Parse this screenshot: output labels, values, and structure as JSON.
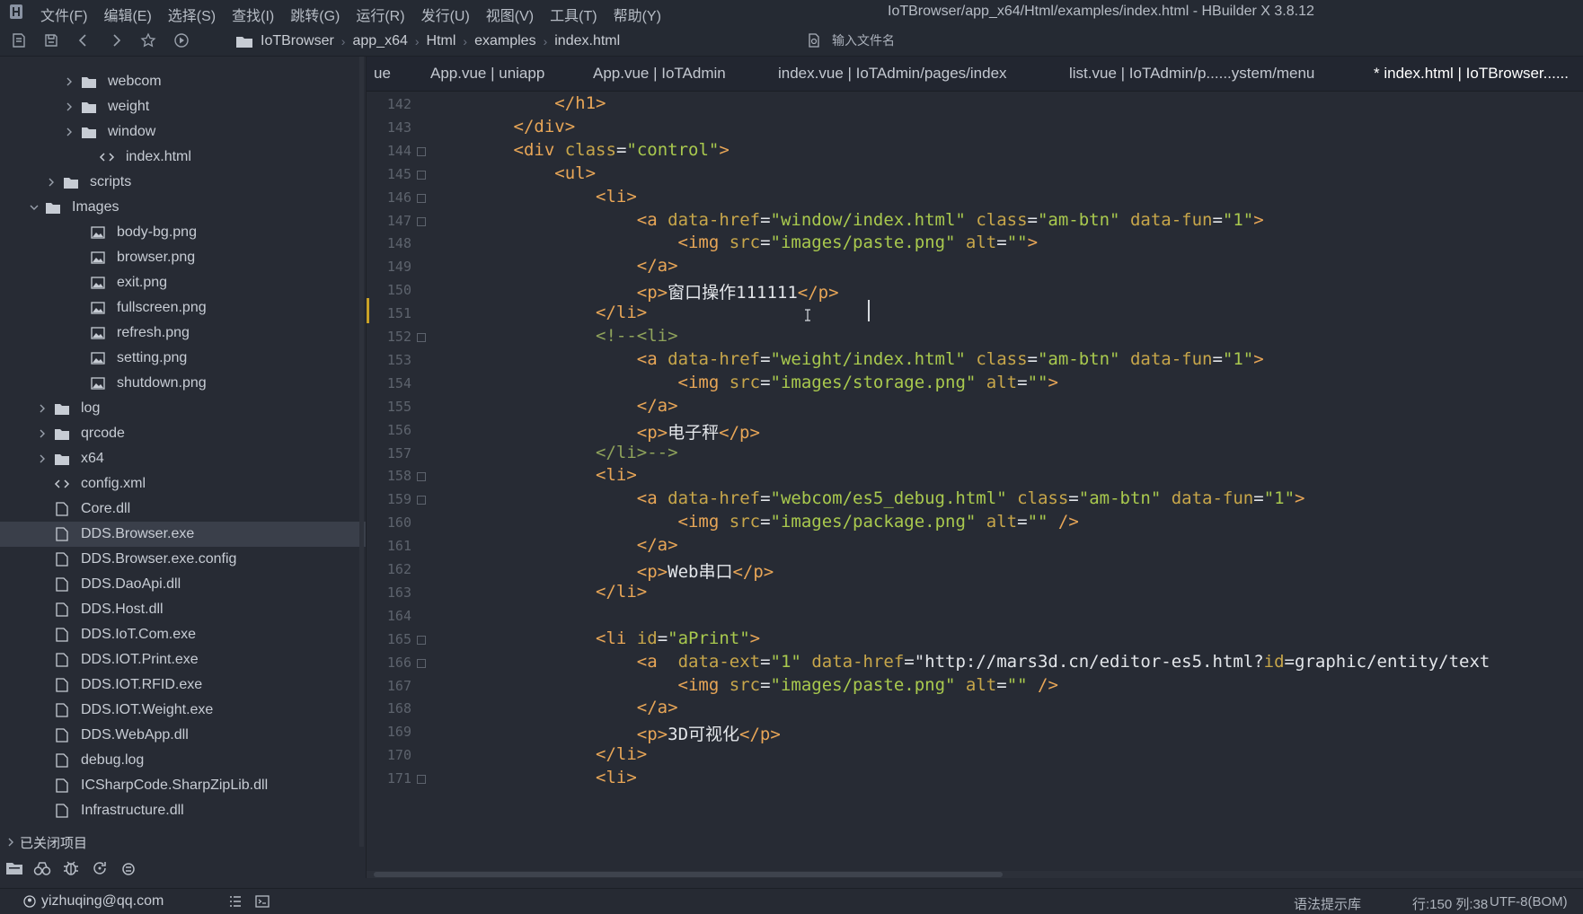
{
  "menu": [
    "文件(F)",
    "编辑(E)",
    "选择(S)",
    "查找(I)",
    "跳转(G)",
    "运行(R)",
    "发行(U)",
    "视图(V)",
    "工具(T)",
    "帮助(Y)"
  ],
  "window_title": "IoTBrowser/app_x64/Html/examples/index.html - HBuilder X 3.8.12",
  "breadcrumb": [
    "IoTBrowser",
    "app_x64",
    "Html",
    "examples",
    "index.html"
  ],
  "file_search_placeholder": "输入文件名",
  "tree": [
    {
      "label": "webcom",
      "type": "folder",
      "expanded": false
    },
    {
      "label": "weight",
      "type": "folder",
      "expanded": false
    },
    {
      "label": "window",
      "type": "folder",
      "expanded": false
    },
    {
      "label": "index.html",
      "type": "html"
    },
    {
      "label": "scripts",
      "type": "folder",
      "expanded": false
    },
    {
      "label": "Images",
      "type": "folder",
      "expanded": true
    },
    {
      "label": "body-bg.png",
      "type": "image"
    },
    {
      "label": "browser.png",
      "type": "image"
    },
    {
      "label": "exit.png",
      "type": "image"
    },
    {
      "label": "fullscreen.png",
      "type": "image"
    },
    {
      "label": "refresh.png",
      "type": "image"
    },
    {
      "label": "setting.png",
      "type": "image"
    },
    {
      "label": "shutdown.png",
      "type": "image"
    },
    {
      "label": "log",
      "type": "folder",
      "expanded": false
    },
    {
      "label": "qrcode",
      "type": "folder",
      "expanded": false
    },
    {
      "label": "x64",
      "type": "folder",
      "expanded": false
    },
    {
      "label": "config.xml",
      "type": "html"
    },
    {
      "label": "Core.dll",
      "type": "file"
    },
    {
      "label": "DDS.Browser.exe",
      "type": "file",
      "selected": true
    },
    {
      "label": "DDS.Browser.exe.config",
      "type": "file"
    },
    {
      "label": "DDS.DaoApi.dll",
      "type": "file"
    },
    {
      "label": "DDS.Host.dll",
      "type": "file"
    },
    {
      "label": "DDS.IoT.Com.exe",
      "type": "file"
    },
    {
      "label": "DDS.IOT.Print.exe",
      "type": "file"
    },
    {
      "label": "DDS.IOT.RFID.exe",
      "type": "file"
    },
    {
      "label": "DDS.IOT.Weight.exe",
      "type": "file"
    },
    {
      "label": "DDS.WebApp.dll",
      "type": "file"
    },
    {
      "label": "debug.log",
      "type": "file"
    },
    {
      "label": "ICSharpCode.SharpZipLib.dll",
      "type": "file"
    },
    {
      "label": "Infrastructure.dll",
      "type": "file"
    }
  ],
  "closed_projects_label": "已关闭项目",
  "tabs": [
    {
      "label": "ue",
      "active": false
    },
    {
      "label": "App.vue | uniapp",
      "active": false
    },
    {
      "label": "App.vue | IoTAdmin",
      "active": false
    },
    {
      "label": "index.vue | IoTAdmin/pages/index",
      "active": false
    },
    {
      "label": "list.vue | IoTAdmin/p......ystem/menu",
      "active": false
    },
    {
      "label": "* index.html | IoTBrowser......",
      "active": true
    }
  ],
  "code_lines": [
    {
      "n": "142",
      "text": "            </h1>"
    },
    {
      "n": "143",
      "text": "        </div>"
    },
    {
      "n": "144",
      "text": "        <div class=\"control\">",
      "fold": true
    },
    {
      "n": "145",
      "text": "            <ul>",
      "fold": true
    },
    {
      "n": "146",
      "text": "                <li>",
      "fold": true
    },
    {
      "n": "147",
      "text": "                    <a data-href=\"window/index.html\" class=\"am-btn\" data-fun=\"1\">",
      "fold": true
    },
    {
      "n": "148",
      "text": "                        <img src=\"images/paste.png\" alt=\"\">"
    },
    {
      "n": "149",
      "text": "                    </a>"
    },
    {
      "n": "150",
      "text": "                    <p>窗口操作111111</p>",
      "modified": true
    },
    {
      "n": "151",
      "text": "                </li>"
    },
    {
      "n": "152",
      "text": "                <!--<li>",
      "fold": true
    },
    {
      "n": "153",
      "text": "                    <a data-href=\"weight/index.html\" class=\"am-btn\" data-fun=\"1\">"
    },
    {
      "n": "154",
      "text": "                        <img src=\"images/storage.png\" alt=\"\">"
    },
    {
      "n": "155",
      "text": "                    </a>"
    },
    {
      "n": "156",
      "text": "                    <p>电子秤</p>"
    },
    {
      "n": "157",
      "text": "                </li>-->"
    },
    {
      "n": "158",
      "text": "                <li>",
      "fold": true
    },
    {
      "n": "159",
      "text": "                    <a data-href=\"webcom/es5_debug.html\" class=\"am-btn\" data-fun=\"1\">",
      "fold": true
    },
    {
      "n": "160",
      "text": "                        <img src=\"images/package.png\" alt=\"\" />"
    },
    {
      "n": "161",
      "text": "                    </a>"
    },
    {
      "n": "162",
      "text": "                    <p>Web串口</p>"
    },
    {
      "n": "163",
      "text": "                </li>"
    },
    {
      "n": "164",
      "text": ""
    },
    {
      "n": "165",
      "text": "                <li id=\"aPrint\">",
      "fold": true
    },
    {
      "n": "166",
      "text": "                    <a  data-ext=\"1\" data-href=\"http://mars3d.cn/editor-es5.html?id=graphic/entity/text",
      "fold": true
    },
    {
      "n": "167",
      "text": "                        <img src=\"images/paste.png\" alt=\"\" />"
    },
    {
      "n": "168",
      "text": "                    </a>"
    },
    {
      "n": "169",
      "text": "                    <p>3D可视化</p>"
    },
    {
      "n": "170",
      "text": "                </li>"
    },
    {
      "n": "171",
      "text": "                <li>",
      "fold": true
    }
  ],
  "status": {
    "user": "yizhuqing@qq.com",
    "syntax": "语法提示库",
    "position": "行:150  列:38",
    "encoding": "UTF-8(BOM)"
  },
  "colors": {
    "background": "#272b34",
    "tag": "#e8a657",
    "attr": "#c7a64a",
    "string": "#a9c94e",
    "text": "#e3e6ea",
    "comment": "#8fa35b"
  }
}
